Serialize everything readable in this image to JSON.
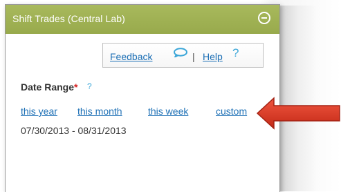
{
  "panel": {
    "title": "Shift Trades (Central Lab)",
    "header_color": "#9dae52",
    "collapse_icon": "minus-circle-icon"
  },
  "links": {
    "feedback": "Feedback",
    "feedback_icon": "speech-bubble-icon",
    "separator": "|",
    "help": "Help",
    "help_icon": "?"
  },
  "date_range": {
    "label": "Date Range",
    "required_mark": "*",
    "help_mark": "?",
    "options": [
      "this year",
      "this month",
      "this week",
      "custom"
    ],
    "value": "07/30/2013 - 08/31/2013"
  },
  "colors": {
    "link": "#1c6fb5",
    "accent_icon": "#3aa6d8",
    "arrow": "#d9321e"
  }
}
